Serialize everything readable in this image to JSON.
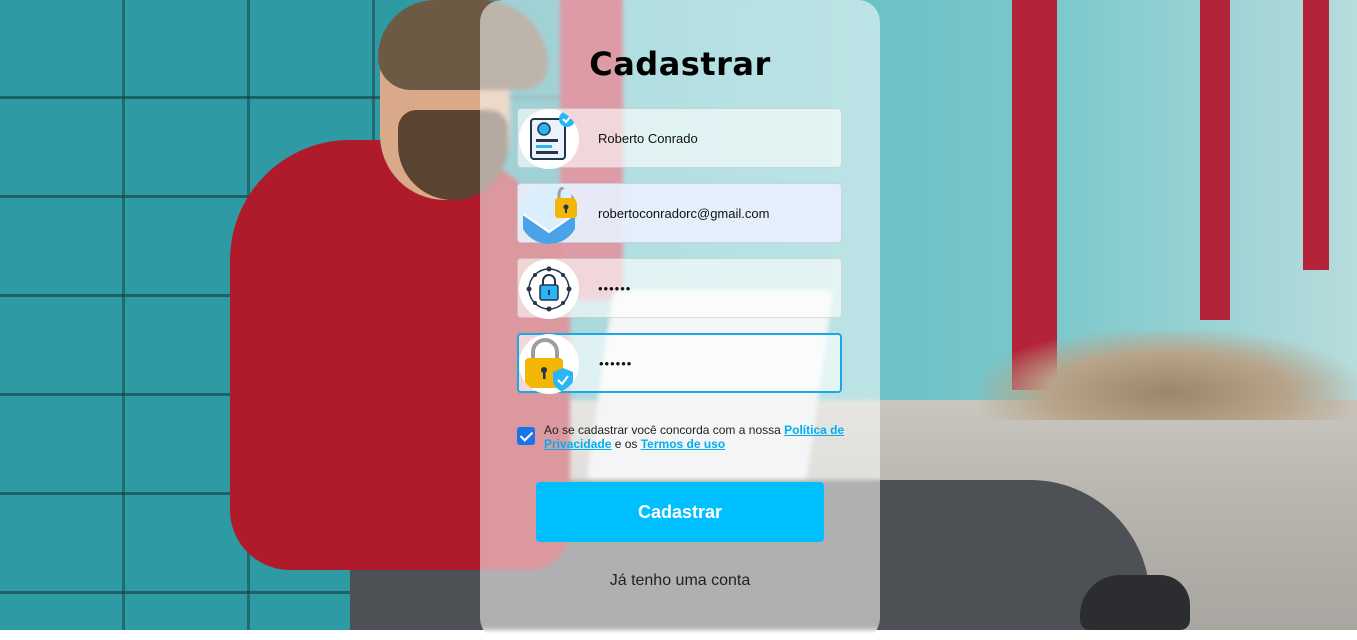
{
  "form": {
    "title": "Cadastrar",
    "fields": [
      {
        "name": "name",
        "type": "text",
        "value": "Roberto Conrado",
        "icon": "id-card-icon"
      },
      {
        "name": "email",
        "type": "email",
        "value": "robertoconradorc@gmail.com",
        "icon": "mail-lock-icon"
      },
      {
        "name": "password",
        "type": "password",
        "value": "••••••",
        "icon": "security-lock-icon"
      },
      {
        "name": "confirm_password",
        "type": "password",
        "value": "••••••",
        "icon": "padlock-shield-icon"
      }
    ],
    "terms": {
      "checked": true,
      "prefix": "Ao se cadastrar você concorda com a nossa ",
      "privacy_link": "Política de Privacidade",
      "middle": " e os ",
      "terms_link": "Termos de uso"
    },
    "submit_label": "Cadastrar",
    "login_link": "Já tenho uma conta"
  },
  "colors": {
    "accent": "#00bfff",
    "link": "#00aef0",
    "focus_border": "#1aa8e6",
    "checkbox": "#1a73e8"
  }
}
